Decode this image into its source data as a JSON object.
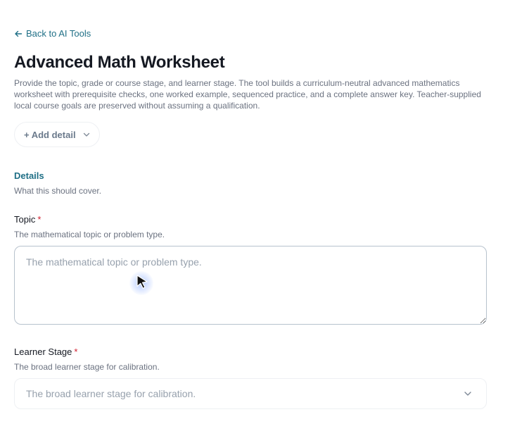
{
  "nav": {
    "back_label": "Back to AI Tools"
  },
  "header": {
    "title": "Advanced Math Worksheet",
    "description": "Provide the topic, grade or course stage, and learner stage. The tool builds a curriculum-neutral advanced mathematics worksheet with prerequisite checks, one worked example, sequenced practice, and a complete answer key. Teacher-supplied local course goals are preserved without assuming a qualification."
  },
  "add_detail": {
    "label": "+ Add detail"
  },
  "details_section": {
    "title": "Details",
    "subtitle": "What this should cover."
  },
  "fields": {
    "topic": {
      "label": "Topic",
      "required_mark": "*",
      "help": "The mathematical topic or problem type.",
      "placeholder": "The mathematical topic or problem type.",
      "value": ""
    },
    "learner_stage": {
      "label": "Learner Stage",
      "required_mark": "*",
      "help": "The broad learner stage for calibration.",
      "placeholder": "The broad learner stage for calibration."
    }
  },
  "colors": {
    "accent": "#1f6f86",
    "required": "#d11f2f",
    "muted_text": "#6b7280",
    "placeholder": "#97a1ad"
  },
  "icons": {
    "back": "arrow-left-icon",
    "add_detail_chevron": "chevron-down-icon",
    "select_chevron": "chevron-down-icon",
    "cursor": "mouse-pointer-icon"
  }
}
